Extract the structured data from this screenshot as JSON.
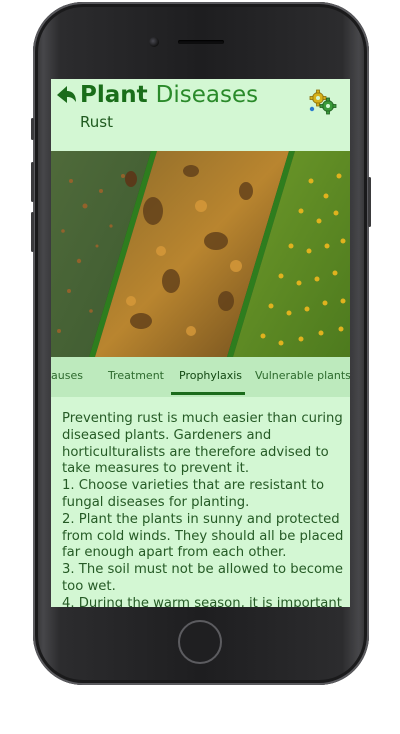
{
  "app": {
    "title_bold": "Plant",
    "title_light": "Diseases",
    "subtitle": "Rust"
  },
  "header": {
    "back_icon": "arrow-left-icon",
    "settings_icon": "gears-icon"
  },
  "tabs": [
    {
      "label": "auses",
      "active": false
    },
    {
      "label": "Treatment",
      "active": false
    },
    {
      "label": "Prophylaxis",
      "active": true
    },
    {
      "label": "Vulnerable plants",
      "active": false
    }
  ],
  "content": {
    "paragraphs": [
      "Preventing rust is much easier than curing diseased plants. Gardeners and horticulturalists are therefore advised to take measures to prevent it.",
      "1.  Choose varieties that are resistant to fungal diseases for planting.",
      "2.  Plant the plants in sunny and protected from cold winds. They should all be placed far enough apart from each other.",
      "3.  The soil must not be allowed to become too wet.",
      "4.  During the warm season, it is important"
    ]
  },
  "colors": {
    "accent": "#1b6b1b",
    "screen_bg": "#d3f7d3",
    "tab_bar_bg": "#bdeabd"
  }
}
